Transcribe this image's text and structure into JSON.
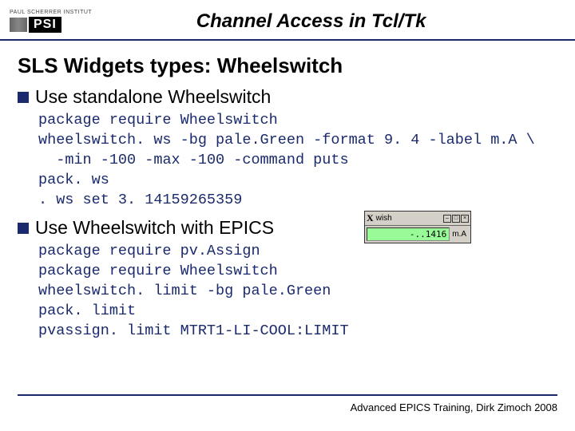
{
  "logo": {
    "topText": "PAUL SCHERRER INSTITUT",
    "text": "PSI"
  },
  "header": {
    "title": "Channel Access in Tcl/Tk"
  },
  "slide": {
    "heading": "SLS Widgets types: Wheelswitch",
    "bullets": [
      {
        "text": "Use standalone Wheelswitch"
      },
      {
        "text": "Use Wheelswitch with EPICS"
      }
    ],
    "code1": "package require Wheelswitch\nwheelswitch. ws -bg pale.Green -format 9. 4 -label m.A \\\n  -min -100 -max -100 -command puts\npack. ws\n. ws set 3. 14159265359",
    "code2": "package require pv.Assign\npackage require Wheelswitch\nwheelswitch. limit -bg pale.Green\npack. limit\npvassign. limit MTRT1-LI-COOL:LIMIT"
  },
  "widgetDemo": {
    "windowTitle": "wish",
    "minimize": "–",
    "maximize": "□",
    "close": "×",
    "display": "-..1416",
    "unit": "m.A"
  },
  "footer": {
    "text": "Advanced EPICS Training, Dirk Zimoch 2008"
  }
}
